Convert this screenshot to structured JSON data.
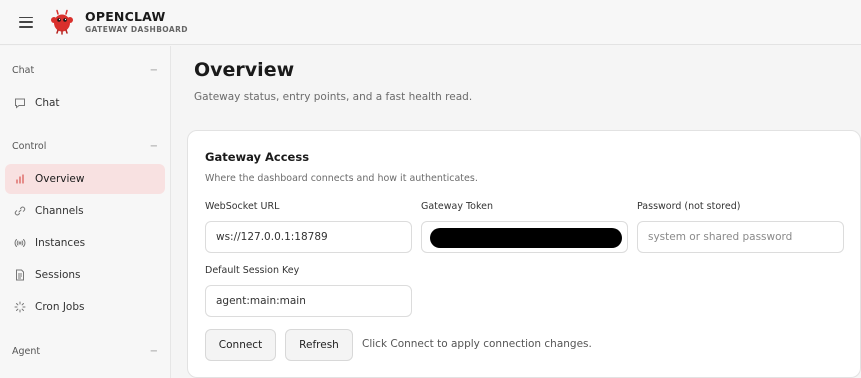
{
  "header": {
    "brand_title": "OPENCLAW",
    "brand_subtitle": "GATEWAY DASHBOARD",
    "brand_color": "#d9302c"
  },
  "sidebar": {
    "groups": [
      {
        "label": "Chat",
        "collapse_glyph": "−",
        "items": [
          {
            "label": "Chat",
            "icon": "message-icon",
            "active": false
          }
        ]
      },
      {
        "label": "Control",
        "collapse_glyph": "−",
        "items": [
          {
            "label": "Overview",
            "icon": "bar-chart-icon",
            "active": true
          },
          {
            "label": "Channels",
            "icon": "link-icon",
            "active": false
          },
          {
            "label": "Instances",
            "icon": "radio-icon",
            "active": false
          },
          {
            "label": "Sessions",
            "icon": "file-icon",
            "active": false
          },
          {
            "label": "Cron Jobs",
            "icon": "loader-icon",
            "active": false
          }
        ]
      },
      {
        "label": "Agent",
        "collapse_glyph": "−",
        "items": []
      }
    ],
    "active_color": "#f8e1e1",
    "active_icon_color": "#d9534f"
  },
  "main": {
    "title": "Overview",
    "subtitle": "Gateway status, entry points, and a fast health read.",
    "card": {
      "title": "Gateway Access",
      "subtitle": "Where the dashboard connects and how it authenticates.",
      "websocket": {
        "label": "WebSocket URL",
        "value": "ws://127.0.0.1:18789"
      },
      "token": {
        "label": "Gateway Token",
        "value": ""
      },
      "password": {
        "label": "Password (not stored)",
        "value": "",
        "placeholder": "system or shared password"
      },
      "session_key": {
        "label": "Default Session Key",
        "value": "agent:main:main"
      },
      "connect_label": "Connect",
      "refresh_label": "Refresh",
      "hint": "Click Connect to apply connection changes."
    }
  }
}
